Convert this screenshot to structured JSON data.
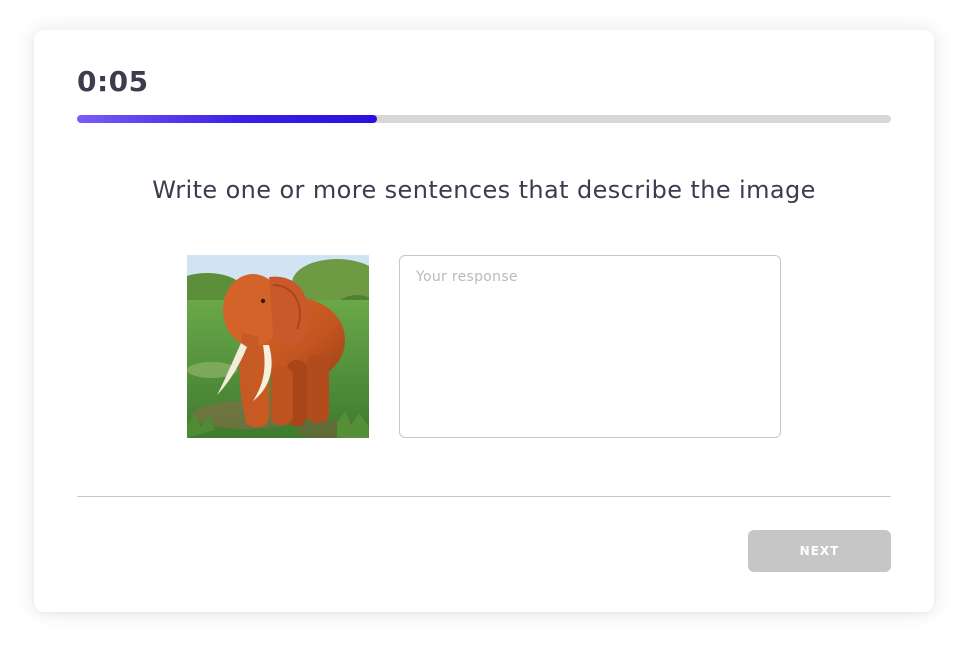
{
  "timer": {
    "value": "0:05",
    "progress_fraction": 0.368
  },
  "question": {
    "prompt": "Write one or more sentences that describe the image",
    "image_subject": "elephant-photo"
  },
  "response": {
    "placeholder": "Your response",
    "value": ""
  },
  "footer": {
    "next_label": "NEXT"
  },
  "colors": {
    "progress_start": "#7a5cf5",
    "progress_end": "#2a10e0",
    "track": "#d9d6d8",
    "text": "#3c3c4e",
    "button_disabled": "#c6c6c6"
  }
}
